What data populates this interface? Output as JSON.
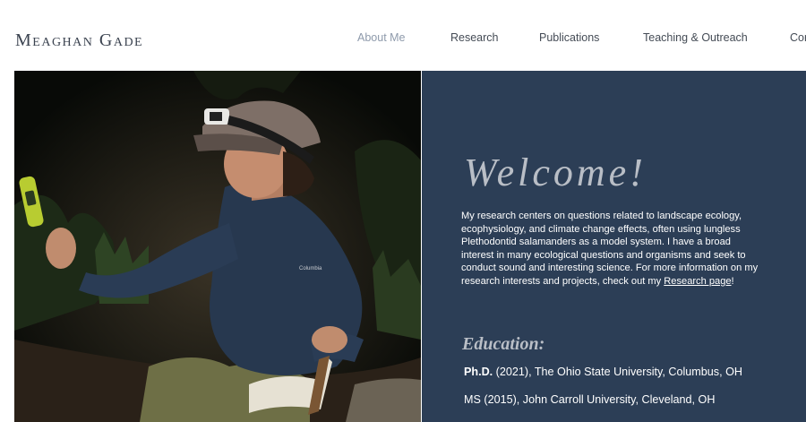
{
  "header": {
    "site_title": "Meaghan Gade",
    "nav": [
      {
        "label": "About Me",
        "active": true
      },
      {
        "label": "Research",
        "active": false
      },
      {
        "label": "Publications",
        "active": false
      },
      {
        "label": "Teaching & Outreach",
        "active": false
      },
      {
        "label": "Cor",
        "active": false
      }
    ]
  },
  "hero": {
    "welcome": "Welcome!",
    "intro_text": "My research centers on questions related to landscape ecology, ecophysiology, and climate change effects, often using lungless Plethodontid salamanders as a model system. I have a broad interest in many ecological questions and organisms and seek to conduct sound and interesting science.  For more information on my research interests and projects, check out my ",
    "intro_link": "Research page",
    "intro_end": "!",
    "education_heading": "Education:",
    "education": [
      {
        "degree": "Ph.D.",
        "detail": " (2021), The Ohio State University, Columbus, OH"
      },
      {
        "degree": "MS",
        "detail": " (2015), John Carroll University, Cleveland, OH"
      }
    ]
  },
  "colors": {
    "panel": "#2c3e56",
    "heading": "#b9bec6",
    "nav_active": "#8e9aab"
  },
  "photo": {
    "icon": "field-researcher-photo",
    "jacket_logo": "Columbia"
  }
}
